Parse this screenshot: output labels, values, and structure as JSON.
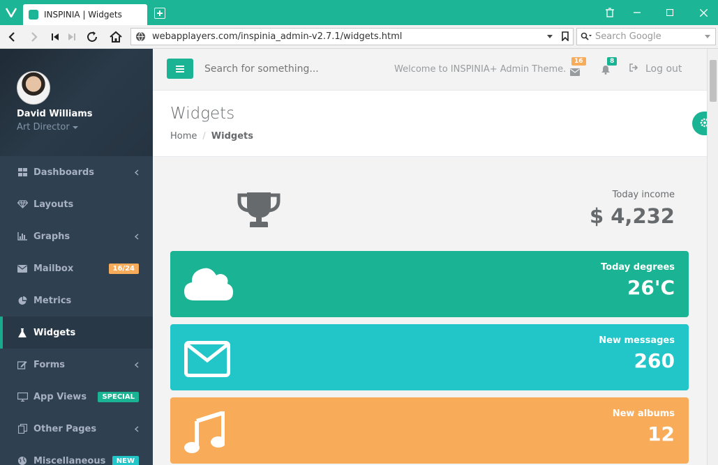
{
  "browser": {
    "tab_title": "INSPINIA | Widgets",
    "url": "webapplayers.com/inspinia_admin-v2.7.1/widgets.html",
    "search_placeholder": "Search Google"
  },
  "profile": {
    "name": "David Williams",
    "role": "Art Director"
  },
  "sidebar": {
    "items": [
      {
        "label": "Dashboards",
        "icon": "th-large-icon",
        "has_arrow": true
      },
      {
        "label": "Layouts",
        "icon": "diamond-icon"
      },
      {
        "label": "Graphs",
        "icon": "bar-chart-icon",
        "has_arrow": true
      },
      {
        "label": "Mailbox",
        "icon": "envelope-icon",
        "badge": "16/24"
      },
      {
        "label": "Metrics",
        "icon": "pie-chart-icon"
      },
      {
        "label": "Widgets",
        "icon": "flask-icon",
        "active": true
      },
      {
        "label": "Forms",
        "icon": "edit-icon",
        "has_arrow": true
      },
      {
        "label": "App Views",
        "icon": "desktop-icon",
        "badge": "SPECIAL"
      },
      {
        "label": "Other Pages",
        "icon": "files-icon",
        "has_arrow": true
      },
      {
        "label": "Miscellaneous",
        "icon": "globe-icon",
        "badge": "NEW"
      }
    ]
  },
  "topbar": {
    "search_placeholder": "Search for something...",
    "welcome": "Welcome to INSPINIA+ Admin Theme.",
    "mail_count": "16",
    "alert_count": "8",
    "logout": "Log out"
  },
  "page": {
    "title": "Widgets",
    "breadcrumb_home": "Home",
    "breadcrumb_current": "Widgets"
  },
  "widgets": [
    {
      "label": "Today income",
      "value": "$ 4,232",
      "icon": "trophy-icon"
    },
    {
      "label": "Today degrees",
      "value": "26'C",
      "icon": "cloud-icon",
      "color": "#1ab394"
    },
    {
      "label": "New messages",
      "value": "260",
      "icon": "envelope-icon",
      "color": "#23c6c8"
    },
    {
      "label": "New albums",
      "value": "12",
      "icon": "music-icon",
      "color": "#f8ac59"
    }
  ],
  "colors": {
    "primary": "#1ab394",
    "info": "#23c6c8",
    "warning": "#f8ac59",
    "sidebar": "#2f4050"
  }
}
